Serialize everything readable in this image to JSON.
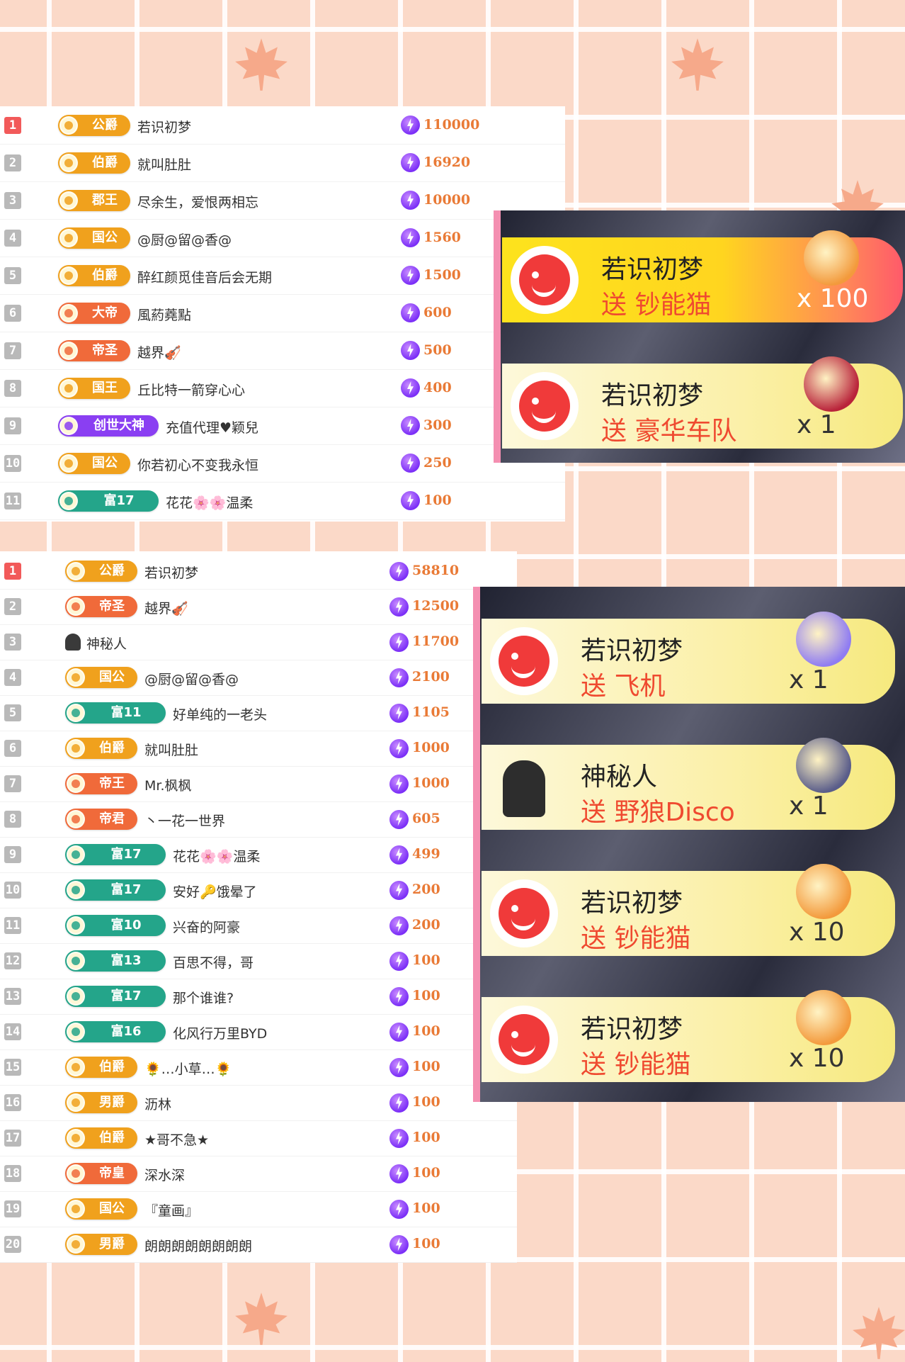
{
  "colors": {
    "accent_amount": "#e97a36",
    "rank_top": "#f25a5a",
    "rank_other": "#b9b9b9",
    "send": "#ef4a30"
  },
  "list1": [
    {
      "rank": "1",
      "badge": "公爵",
      "badge_color": "#f0a11d",
      "nick": "若识初梦",
      "amount": "110000"
    },
    {
      "rank": "2",
      "badge": "伯爵",
      "badge_color": "#f0a11d",
      "nick": "就叫肚肚",
      "amount": "16920"
    },
    {
      "rank": "3",
      "badge": "郡王",
      "badge_color": "#f0a11d",
      "nick": "尽余生，爱恨两相忘",
      "amount": "10000"
    },
    {
      "rank": "4",
      "badge": "国公",
      "badge_color": "#f0a11d",
      "nick": "@厨@留@香@",
      "amount": "1560"
    },
    {
      "rank": "5",
      "badge": "伯爵",
      "badge_color": "#f0a11d",
      "nick": "醉红颜觅佳音后会无期",
      "amount": "1500"
    },
    {
      "rank": "6",
      "badge": "大帝",
      "badge_color": "#f06a3a",
      "nick": "風葯蕘點",
      "amount": "600"
    },
    {
      "rank": "7",
      "badge": "帝圣",
      "badge_color": "#f06a3a",
      "nick": "越界🎻",
      "amount": "500"
    },
    {
      "rank": "8",
      "badge": "国王",
      "badge_color": "#f0a11d",
      "nick": "丘比特一箭穿心心",
      "amount": "400"
    },
    {
      "rank": "9",
      "badge": "创世大神",
      "badge_color": "#8a3ff2",
      "nick": "充值代理♥颖兒",
      "amount": "300"
    },
    {
      "rank": "10",
      "badge": "国公",
      "badge_color": "#f0a11d",
      "nick": "你若初心不变我永恒",
      "amount": "250"
    },
    {
      "rank": "11",
      "badge": "富17",
      "badge_color": "#24a58a",
      "nick": "花花🌸🌸温柔",
      "amount": "100"
    }
  ],
  "list2": [
    {
      "rank": "1",
      "badge": "公爵",
      "badge_color": "#f0a11d",
      "nick": "若识初梦",
      "amount": "58810"
    },
    {
      "rank": "2",
      "badge": "帝圣",
      "badge_color": "#f06a3a",
      "nick": "越界🎻",
      "amount": "12500"
    },
    {
      "rank": "3",
      "badge": "",
      "badge_color": "",
      "nick": "神秘人",
      "amount": "11700"
    },
    {
      "rank": "4",
      "badge": "国公",
      "badge_color": "#f0a11d",
      "nick": "@厨@留@香@",
      "amount": "2100"
    },
    {
      "rank": "5",
      "badge": "富11",
      "badge_color": "#24a58a",
      "nick": "好单纯的一老头",
      "amount": "1105"
    },
    {
      "rank": "6",
      "badge": "伯爵",
      "badge_color": "#f0a11d",
      "nick": "就叫肚肚",
      "amount": "1000"
    },
    {
      "rank": "7",
      "badge": "帝王",
      "badge_color": "#f06a3a",
      "nick": "Mr.枫枫",
      "amount": "1000"
    },
    {
      "rank": "8",
      "badge": "帝君",
      "badge_color": "#f06a3a",
      "nick": "丶一花一世界",
      "amount": "605"
    },
    {
      "rank": "9",
      "badge": "富17",
      "badge_color": "#24a58a",
      "nick": "花花🌸🌸温柔",
      "amount": "499"
    },
    {
      "rank": "10",
      "badge": "富17",
      "badge_color": "#24a58a",
      "nick": "安好🔑饿晕了",
      "amount": "200"
    },
    {
      "rank": "11",
      "badge": "富10",
      "badge_color": "#24a58a",
      "nick": "兴奋的阿豪",
      "amount": "200"
    },
    {
      "rank": "12",
      "badge": "富13",
      "badge_color": "#24a58a",
      "nick": "百思不得，哥",
      "amount": "100"
    },
    {
      "rank": "13",
      "badge": "富17",
      "badge_color": "#24a58a",
      "nick": "那个谁谁?",
      "amount": "100"
    },
    {
      "rank": "14",
      "badge": "富16",
      "badge_color": "#24a58a",
      "nick": "化风行万里BYD",
      "amount": "100"
    },
    {
      "rank": "15",
      "badge": "伯爵",
      "badge_color": "#f0a11d",
      "nick": "🌻…小草…🌻",
      "amount": "100"
    },
    {
      "rank": "16",
      "badge": "男爵",
      "badge_color": "#f0a11d",
      "nick": "沥林",
      "amount": "100"
    },
    {
      "rank": "17",
      "badge": "伯爵",
      "badge_color": "#f0a11d",
      "nick": "★哥不急★",
      "amount": "100"
    },
    {
      "rank": "18",
      "badge": "帝皇",
      "badge_color": "#f06a3a",
      "nick": "深水深",
      "amount": "100"
    },
    {
      "rank": "19",
      "badge": "国公",
      "badge_color": "#f0a11d",
      "nick": "『童画』",
      "amount": "100"
    },
    {
      "rank": "20",
      "badge": "男爵",
      "badge_color": "#f0a11d",
      "nick": "朗朗朗朗朗朗朗朗",
      "amount": "100"
    }
  ],
  "gifts1": [
    {
      "name": "若识初梦",
      "send_text": "送 钞能猫",
      "qty": "x 100",
      "top": true,
      "avatar": "red-face",
      "gift_color": "#f39a3c"
    },
    {
      "name": "若识初梦",
      "send_text": "送 豪华车队",
      "qty": "x 1",
      "top": false,
      "avatar": "red-face",
      "gift_color": "#b9233a"
    }
  ],
  "gifts2": [
    {
      "name": "若识初梦",
      "send_text": "送 飞机",
      "qty": "x 1",
      "top": false,
      "avatar": "red-face",
      "gift_color": "#8f7cf2"
    },
    {
      "name": "神秘人",
      "send_text": "送 野狼Disco",
      "qty": "x 1",
      "top": false,
      "avatar": "mystery",
      "gift_color": "#5a5d8a"
    },
    {
      "name": "若识初梦",
      "send_text": "送 钞能猫",
      "qty": "x 10",
      "top": false,
      "avatar": "red-face",
      "gift_color": "#f39a3c"
    },
    {
      "name": "若识初梦",
      "send_text": "送 钞能猫",
      "qty": "x 10",
      "top": false,
      "avatar": "red-face",
      "gift_color": "#f39a3c"
    }
  ]
}
